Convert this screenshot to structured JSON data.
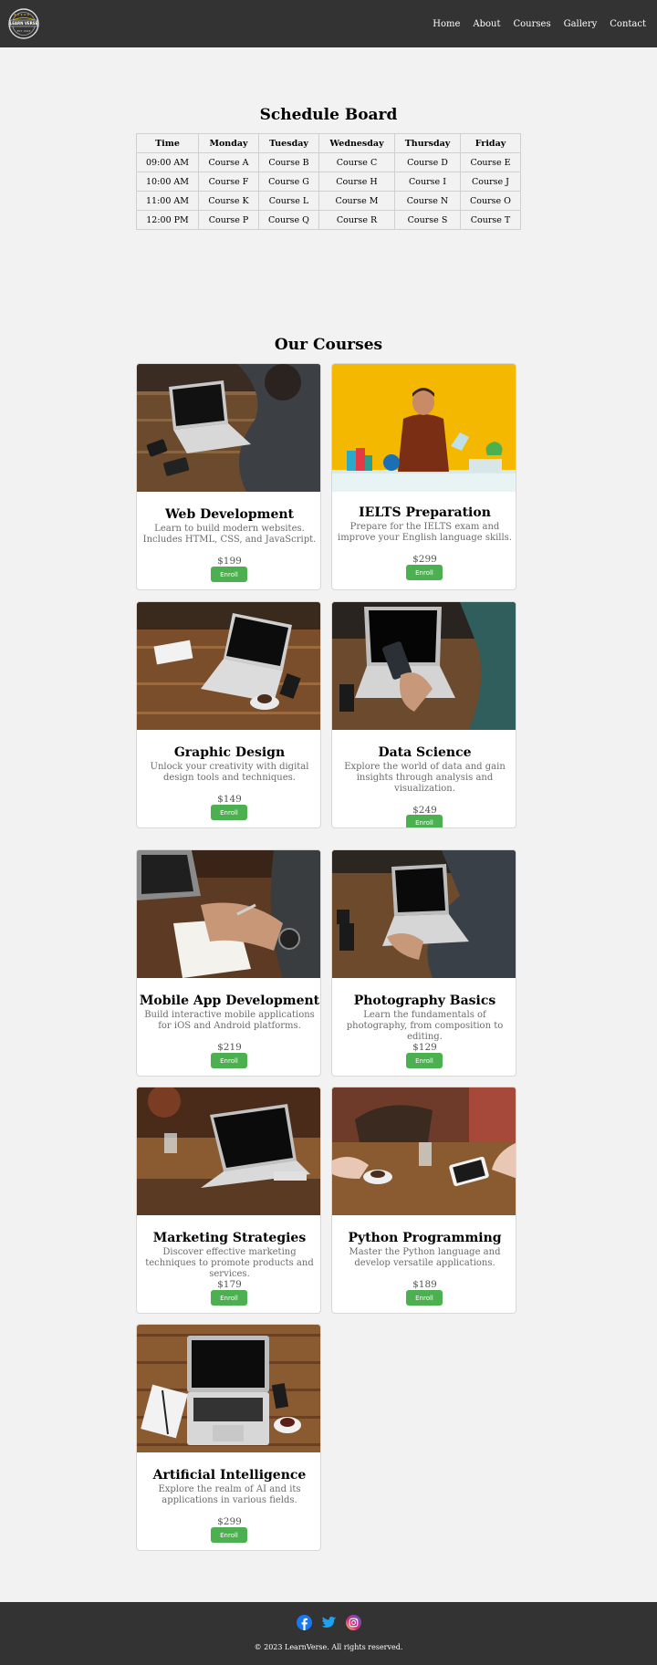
{
  "header": {
    "logo_text_top": "LEARN VERSE",
    "logo_text_bottom": "EST. 2023",
    "nav": [
      "Home",
      "About",
      "Courses",
      "Gallery",
      "Contact"
    ]
  },
  "schedule": {
    "title": "Schedule Board",
    "columns": [
      "Time",
      "Monday",
      "Tuesday",
      "Wednesday",
      "Thursday",
      "Friday"
    ],
    "rows": [
      [
        "09:00 AM",
        "Course A",
        "Course B",
        "Course C",
        "Course D",
        "Course E"
      ],
      [
        "10:00 AM",
        "Course F",
        "Course G",
        "Course H",
        "Course I",
        "Course J"
      ],
      [
        "11:00 AM",
        "Course K",
        "Course L",
        "Course M",
        "Course N",
        "Course O"
      ],
      [
        "12:00 PM",
        "Course P",
        "Course Q",
        "Course R",
        "Course S",
        "Course T"
      ]
    ]
  },
  "courses": {
    "title": "Our Courses",
    "enroll_label": "Enroll",
    "items": [
      {
        "title": "Web Development",
        "desc": "Learn to build modern websites. Includes HTML, CSS, and JavaScript.",
        "price": "$199",
        "image": "laptop-desk-photo"
      },
      {
        "title": "IELTS Preparation",
        "desc": "Prepare for the IELTS exam and improve your English language skills.",
        "price": "$299",
        "image": "student-desk-yellow-photo"
      },
      {
        "title": "Graphic Design",
        "desc": "Unlock your creativity with digital design tools and techniques.",
        "price": "$149",
        "image": "laptop-coffee-photo"
      },
      {
        "title": "Data Science",
        "desc": "Explore the world of data and gain insights through analysis and visualization.",
        "price": "$249",
        "image": "phone-laptop-photo"
      },
      {
        "title": "Mobile App Development",
        "desc": "Build interactive mobile applications for iOS and Android platforms.",
        "price": "$219",
        "image": "writing-notebook-photo"
      },
      {
        "title": "Photography Basics",
        "desc": "Learn the fundamentals of photography, from composition to editing.",
        "price": "$129",
        "image": "typing-laptop-photo"
      },
      {
        "title": "Marketing Strategies",
        "desc": "Discover effective marketing techniques to promote products and services.",
        "price": "$179",
        "image": "laptop-table-photo"
      },
      {
        "title": "Python Programming",
        "desc": "Master the Python language and develop versatile applications.",
        "price": "$189",
        "image": "meeting-table-photo"
      },
      {
        "title": "Artificial Intelligence",
        "desc": "Explore the realm of AI and its applications in various fields.",
        "price": "$299",
        "image": "laptop-wood-top-photo"
      }
    ]
  },
  "footer": {
    "icons": [
      "facebook-icon",
      "twitter-icon",
      "instagram-icon"
    ],
    "copyright": "© 2023 LearnVerse. All rights reserved."
  },
  "colors": {
    "header_bg": "#333333",
    "page_bg": "#f2f2f2",
    "button": "#4caf50"
  }
}
